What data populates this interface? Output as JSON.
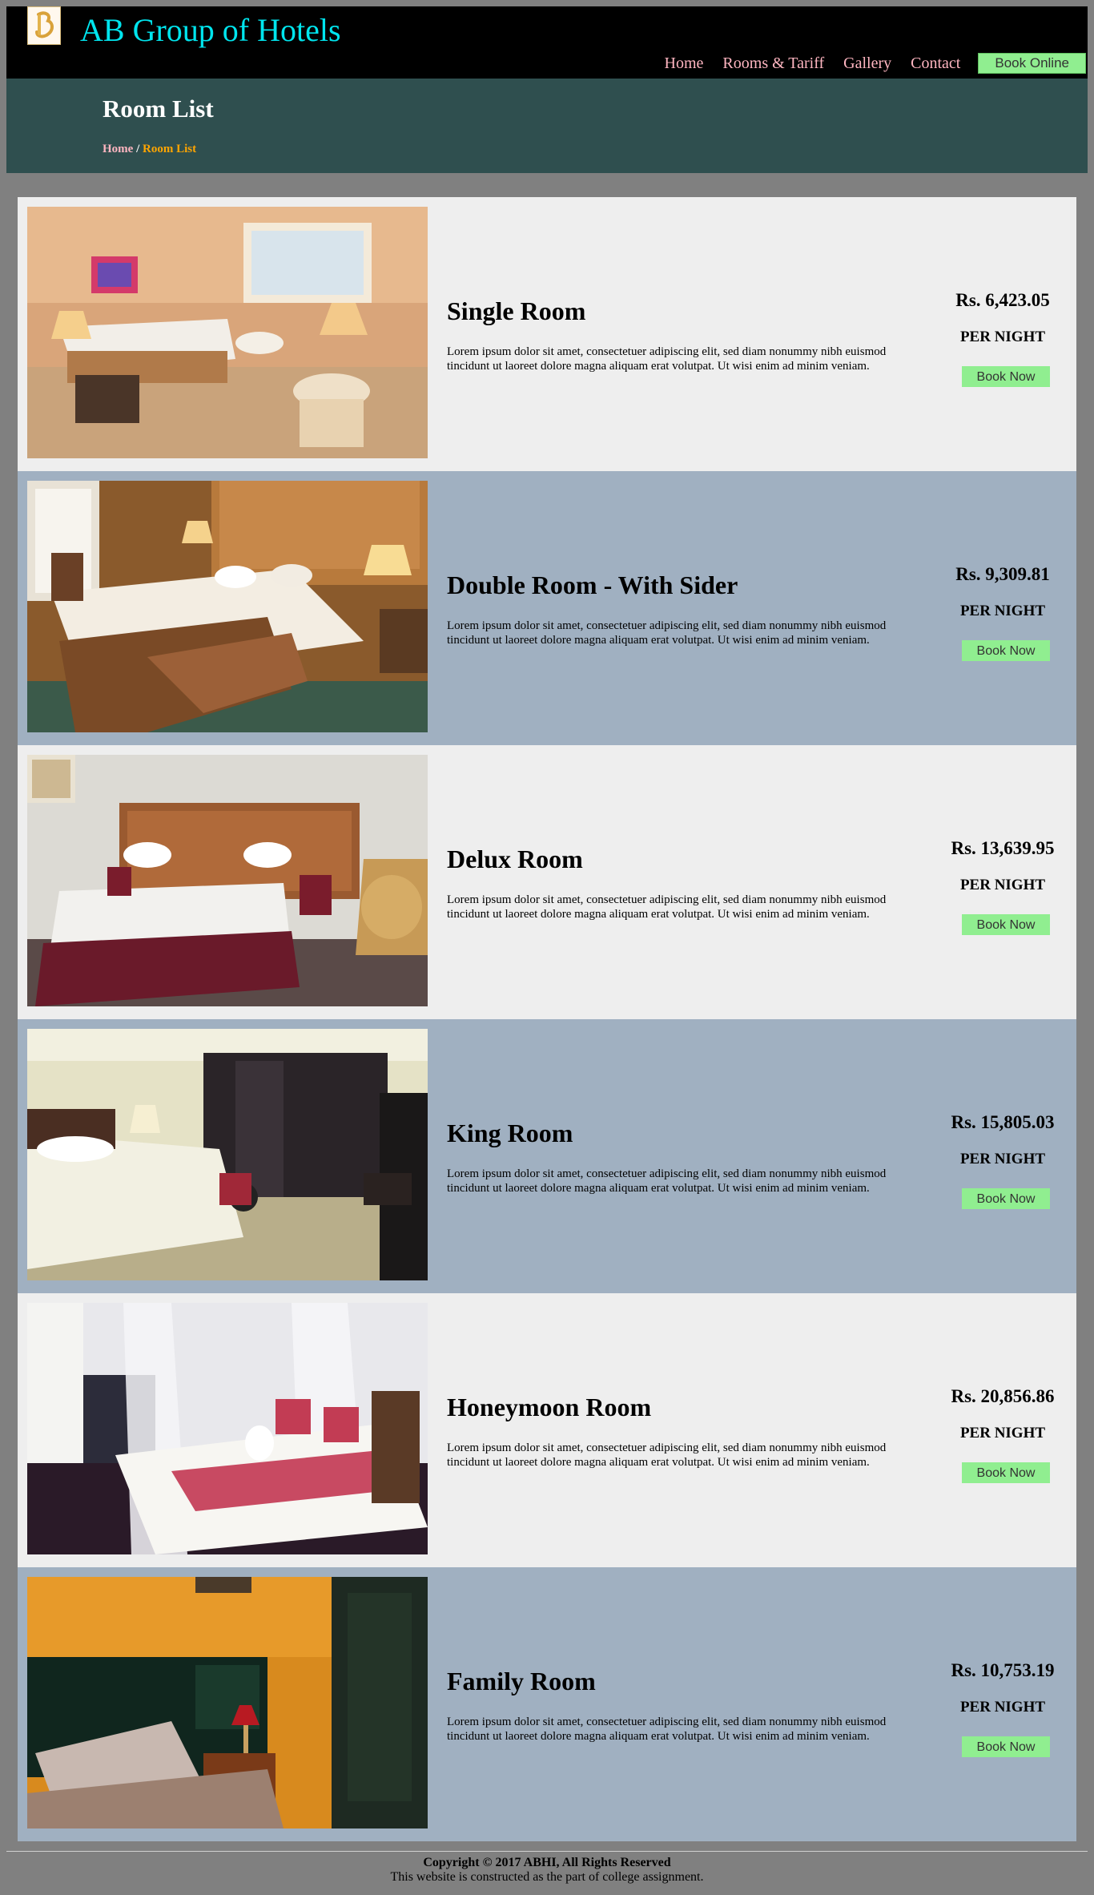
{
  "header": {
    "logo_icon": "b-monogram-logo-icon",
    "title": "AB Group of Hotels",
    "nav": [
      {
        "label": "Home"
      },
      {
        "label": "Rooms & Tariff"
      },
      {
        "label": "Gallery"
      },
      {
        "label": "Contact"
      }
    ],
    "book_online": "Book Online"
  },
  "banner": {
    "title": "Room List",
    "breadcrumb_home": "Home",
    "breadcrumb_sep": " / ",
    "breadcrumb_current": "Room List"
  },
  "rooms": [
    {
      "name": "Single Room",
      "description": "Lorem ipsum dolor sit amet, consectetuer adipiscing elit, sed diam nonummy nibh euismod tincidunt ut laoreet dolore magna aliquam erat volutpat. Ut wisi enim ad minim veniam.",
      "price": "Rs. 6,423.05",
      "per_night": "PER NIGHT",
      "button": "Book Now"
    },
    {
      "name": "Double Room - With Sider",
      "description": "Lorem ipsum dolor sit amet, consectetuer adipiscing elit, sed diam nonummy nibh euismod tincidunt ut laoreet dolore magna aliquam erat volutpat. Ut wisi enim ad minim veniam.",
      "price": "Rs. 9,309.81",
      "per_night": "PER NIGHT",
      "button": "Book Now"
    },
    {
      "name": "Delux Room",
      "description": "Lorem ipsum dolor sit amet, consectetuer adipiscing elit, sed diam nonummy nibh euismod tincidunt ut laoreet dolore magna aliquam erat volutpat. Ut wisi enim ad minim veniam.",
      "price": "Rs. 13,639.95",
      "per_night": "PER NIGHT",
      "button": "Book Now"
    },
    {
      "name": "King Room",
      "description": "Lorem ipsum dolor sit amet, consectetuer adipiscing elit, sed diam nonummy nibh euismod tincidunt ut laoreet dolore magna aliquam erat volutpat. Ut wisi enim ad minim veniam.",
      "price": "Rs. 15,805.03",
      "per_night": "PER NIGHT",
      "button": "Book Now"
    },
    {
      "name": "Honeymoon Room",
      "description": "Lorem ipsum dolor sit amet, consectetuer adipiscing elit, sed diam nonummy nibh euismod tincidunt ut laoreet dolore magna aliquam erat volutpat. Ut wisi enim ad minim veniam.",
      "price": "Rs. 20,856.86",
      "per_night": "PER NIGHT",
      "button": "Book Now"
    },
    {
      "name": "Family Room",
      "description": "Lorem ipsum dolor sit amet, consectetuer adipiscing elit, sed diam nonummy nibh euismod tincidunt ut laoreet dolore magna aliquam erat volutpat. Ut wisi enim ad minim veniam.",
      "price": "Rs. 10,753.19",
      "per_night": "PER NIGHT",
      "button": "Book Now"
    }
  ],
  "footer": {
    "copyright": "Copyright © 2017 ABHI, All Rights Reserved",
    "note": "This website is constructed as the part of college assignment."
  },
  "colors": {
    "header_bg": "#000000",
    "title_color": "#00e5ee",
    "nav_link": "#ffb6c1",
    "button_green": "#90ee90",
    "banner_bg": "#2f4f4f",
    "breadcrumb_current": "#ffa500",
    "row_light": "#eeeeee",
    "row_blue": "#a0b0c1",
    "page_bg": "#808080"
  }
}
